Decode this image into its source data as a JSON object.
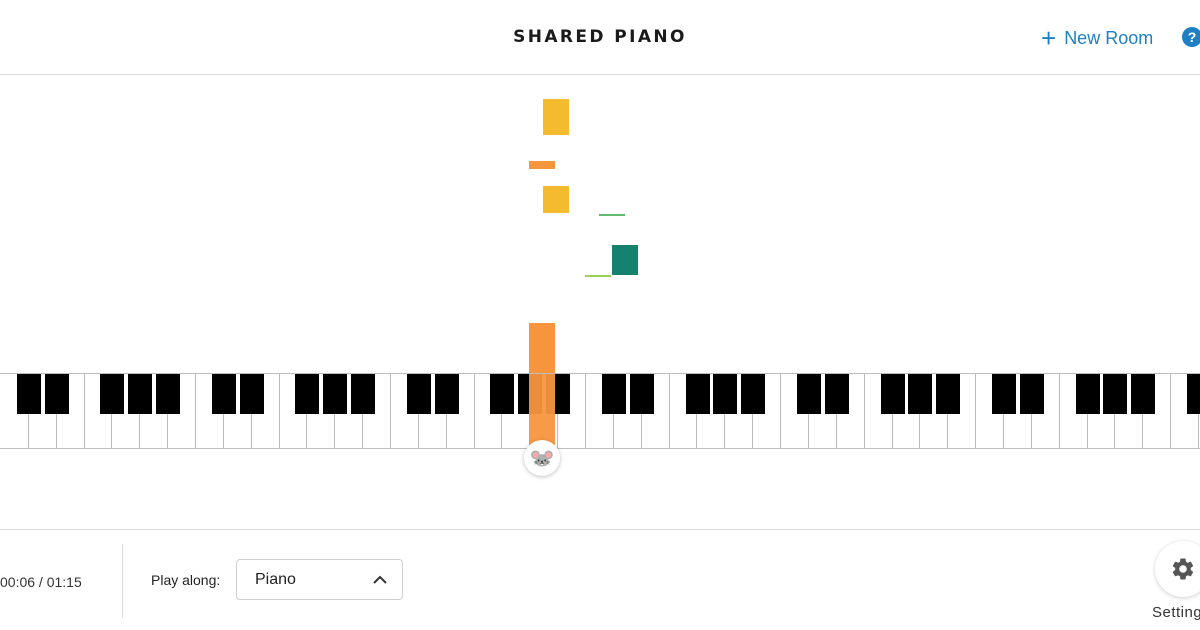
{
  "header": {
    "title": "SHARED PIANO",
    "new_room_label": "New Room",
    "help_symbol": "?",
    "accent_color": "#1e7fc2"
  },
  "roll": {
    "colors": {
      "yellow": "#f4bb2e",
      "orange": "#f7953f",
      "green": "#63b96e",
      "teal": "#14826e",
      "light_green": "#9ccf55"
    }
  },
  "user": {
    "avatar_icon": "mouse-icon",
    "emoji": "🐭"
  },
  "footer": {
    "time": "00:06 / 01:15",
    "play_along_label": "Play along:",
    "instrument": "Piano",
    "settings_label": "Settings"
  }
}
